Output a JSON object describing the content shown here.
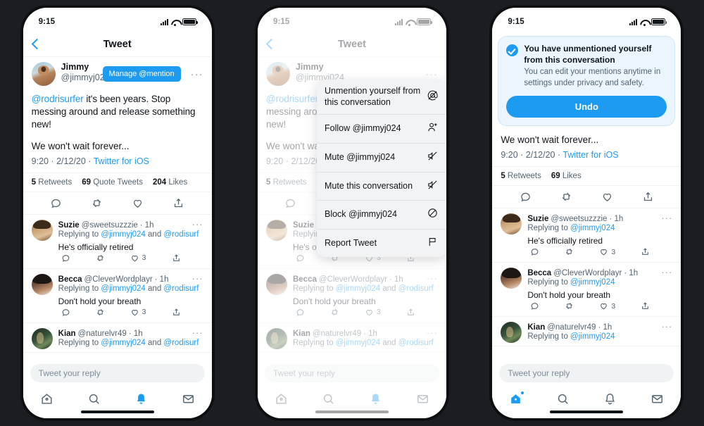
{
  "background_color": "#1a1d21",
  "accent_color": "#1d9bf0",
  "status_bar": {
    "time": "9:15"
  },
  "nav": {
    "title": "Tweet"
  },
  "tweet": {
    "display_name": "Jimmy",
    "handle": "@jimmyj024",
    "manage_pill": "Manage @mention",
    "mention": "@rodrisurfer",
    "text": " it's been years. Stop messing around and release something new!",
    "text2": "We won't wait forever...",
    "time": "9:20",
    "date": "2/12/20",
    "client": "Twitter for iOS",
    "more_dots": "···"
  },
  "stats_full": [
    {
      "count": "5",
      "label": "Retweets"
    },
    {
      "count": "69",
      "label": "Quote Tweets"
    },
    {
      "count": "204",
      "label": "Likes"
    }
  ],
  "stats_after_undo": [
    {
      "count": "5",
      "label": "Retweets"
    },
    {
      "count": "69",
      "label": "Likes"
    }
  ],
  "replies_with_rodisurf": [
    {
      "name": "Suzie",
      "handle": "@sweetsuzzzie",
      "time": "· 1h",
      "replying_prefix": "Replying to ",
      "replying_to": "@jimmyj024",
      "and": " and ",
      "replying_to2": "@rodisurf",
      "text": "He's officially retired",
      "likes": "3",
      "avatar": "av-suzie"
    },
    {
      "name": "Becca",
      "handle": "@CleverWordplayr",
      "time": "· 1h",
      "replying_prefix": "Replying to ",
      "replying_to": "@jimmyj024",
      "and": " and ",
      "replying_to2": "@rodisurf",
      "text": "Don't hold your breath",
      "likes": "3",
      "avatar": "av-becca"
    },
    {
      "name": "Kian",
      "handle": "@naturelvr49",
      "time": "· 1h",
      "replying_prefix": "Replying to ",
      "replying_to": "@jimmyj024",
      "and": " and ",
      "replying_to2": "@rodisurf",
      "text": "",
      "likes": "",
      "avatar": "av-kian"
    }
  ],
  "replies_unmentioned": [
    {
      "name": "Suzie",
      "handle": "@sweetsuzzzie",
      "time": "· 1h",
      "replying_prefix": "Replying to ",
      "replying_to": "@jimmyj024",
      "and": "",
      "replying_to2": "",
      "text": "He's officially retired",
      "likes": "3",
      "avatar": "av-suzie"
    },
    {
      "name": "Becca",
      "handle": "@CleverWordplayr",
      "time": "· 1h",
      "replying_prefix": "Replying to ",
      "replying_to": "@jimmyj024",
      "and": "",
      "replying_to2": "",
      "text": "Don't hold your breath",
      "likes": "3",
      "avatar": "av-becca"
    },
    {
      "name": "Kian",
      "handle": "@naturelvr49",
      "time": "· 1h",
      "replying_prefix": "Replying to ",
      "replying_to": "@jimmyj024",
      "and": "",
      "replying_to2": "",
      "text": "",
      "likes": "",
      "avatar": "av-kian"
    }
  ],
  "context_menu": {
    "items": [
      {
        "label": "Unmention yourself from this conversation",
        "icon": "unmention-icon"
      },
      {
        "label": "Follow @jimmyj024",
        "icon": "person-add-icon"
      },
      {
        "label": "Mute @jimmyj024",
        "icon": "mute-icon"
      },
      {
        "label": "Mute this conversation",
        "icon": "mute-icon"
      },
      {
        "label": "Block @jimmyj024",
        "icon": "block-icon"
      },
      {
        "label": "Report Tweet",
        "icon": "flag-icon"
      }
    ]
  },
  "toast": {
    "title": "You have unmentioned yourself from this conversation",
    "subtitle": "You can edit your mentions anytime in settings under privacy and safety.",
    "button": "Undo",
    "icon": "check-circle-icon"
  },
  "composer": {
    "placeholder": "Tweet your reply"
  },
  "tabbar": {
    "items": [
      {
        "name": "home",
        "icon": "home-icon"
      },
      {
        "name": "search",
        "icon": "search-icon"
      },
      {
        "name": "notifications",
        "icon": "bell-icon"
      },
      {
        "name": "messages",
        "icon": "mail-icon"
      }
    ],
    "active_phone1": "notifications",
    "active_phone2": "notifications",
    "active_phone3": "home"
  }
}
